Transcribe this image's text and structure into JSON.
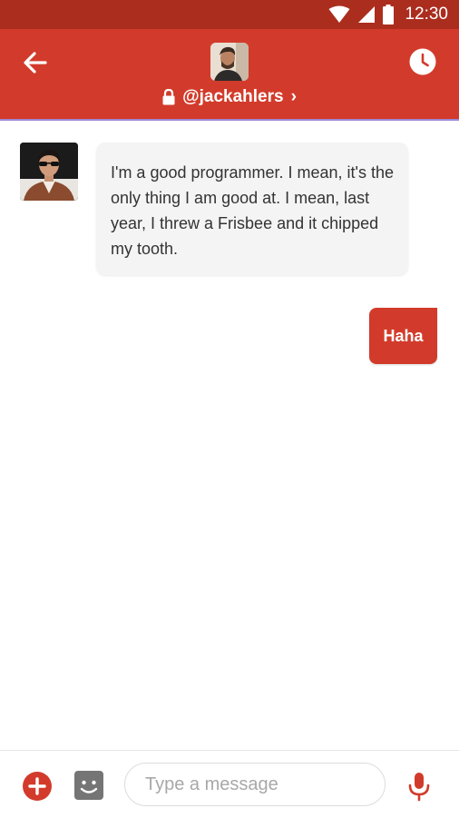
{
  "status_bar": {
    "time": "12:30"
  },
  "header": {
    "username": "@jackahlers",
    "chevron": "›",
    "icons": {
      "back": "arrow-left-icon",
      "lock": "lock-icon",
      "history": "clock-icon"
    }
  },
  "messages": [
    {
      "direction": "incoming",
      "text": "I'm a good programmer. I mean, it's the only thing I am good at. I mean, last year, I threw a Frisbee and it chipped my tooth."
    },
    {
      "direction": "outgoing",
      "text": "Haha"
    }
  ],
  "composer": {
    "placeholder": "Type a message",
    "icons": {
      "add": "plus-circle-icon",
      "sticker": "sticker-icon",
      "mic": "microphone-icon"
    }
  },
  "colors": {
    "status_bar": "#ab2d1e",
    "app_bar": "#d23b2b",
    "accent": "#d23b2b",
    "bubble_in": "#f4f4f4"
  }
}
